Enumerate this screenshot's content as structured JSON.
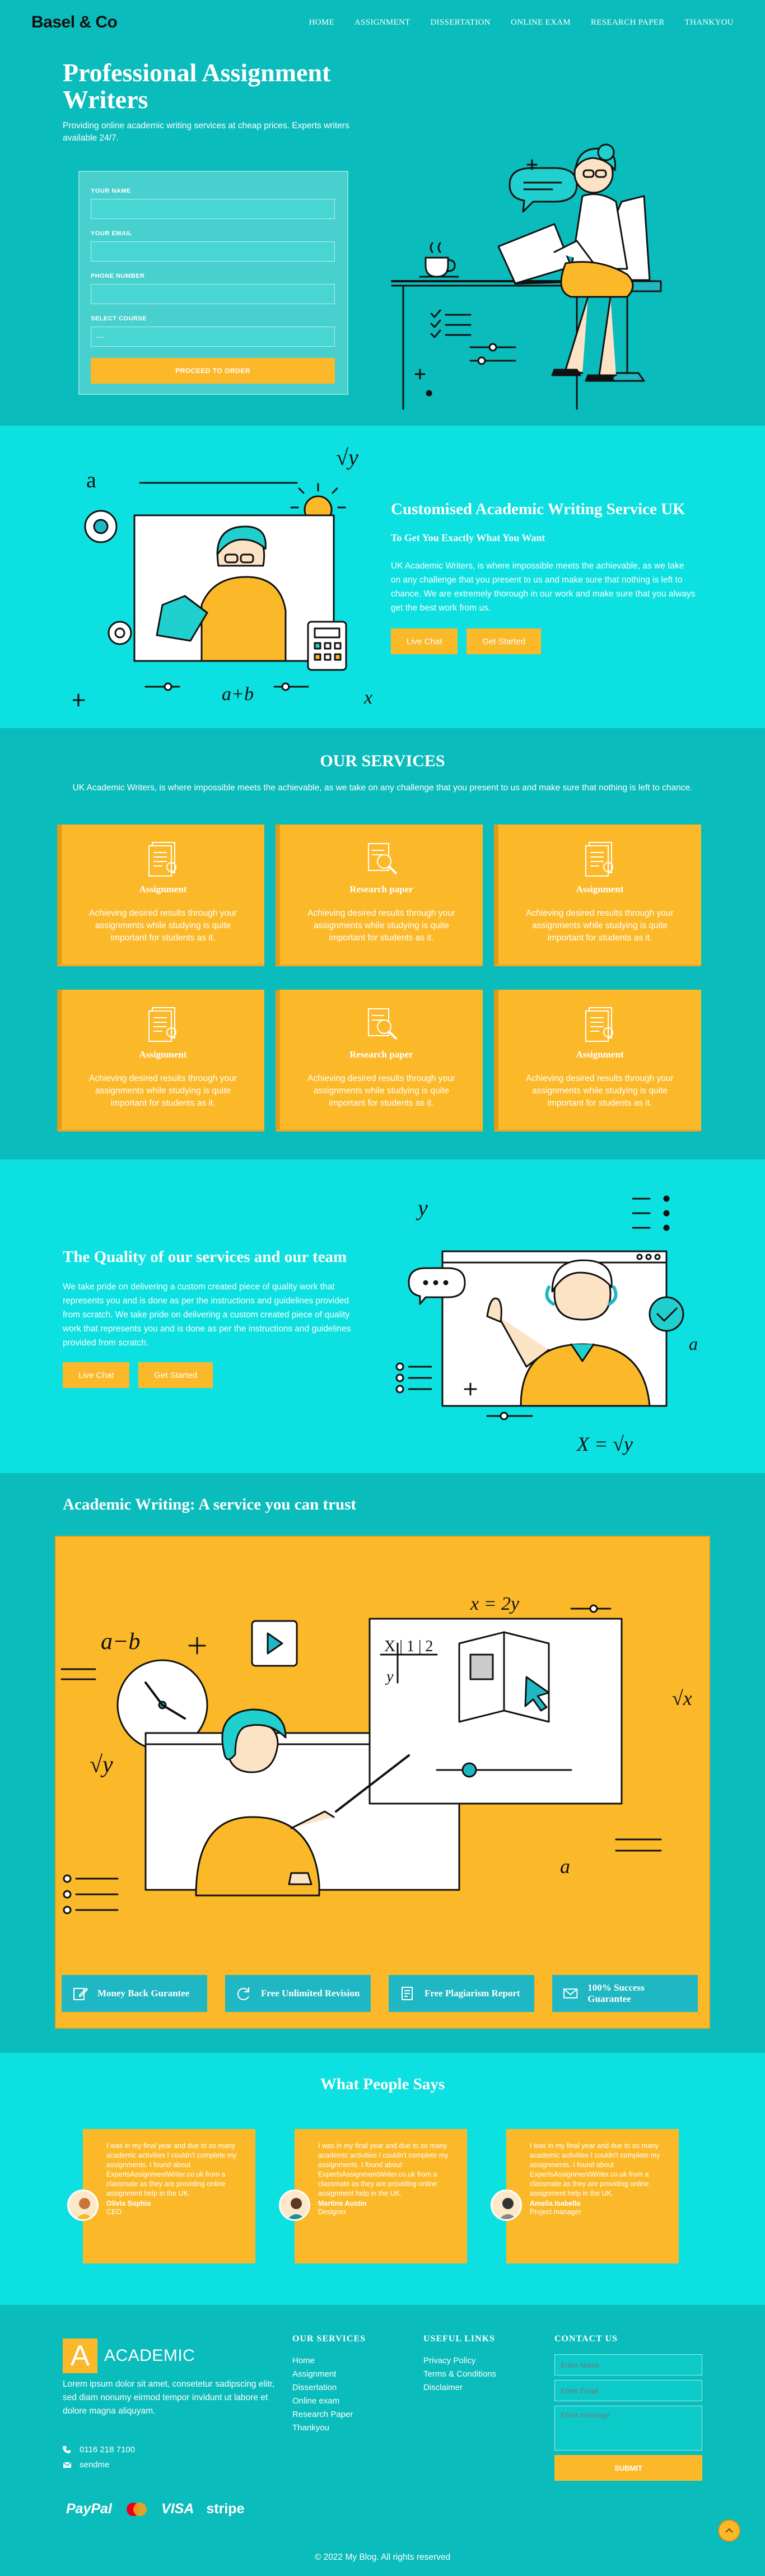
{
  "header": {
    "logo": "Basel & Co",
    "nav": [
      "HOME",
      "ASSIGNMENT",
      "DISSERTATION",
      "ONLINE EXAM",
      "RESEARCH PAPER",
      "THANKYOU"
    ]
  },
  "hero": {
    "title": "Professional Assignment Writers",
    "lead": "Providing online academic writing services at cheap prices. Experts writers available 24/7.",
    "form": {
      "name_label": "YOUR NAME",
      "email_label": "YOUR EMAIL",
      "phone_label": "PHONE NUMBER",
      "course_label": "SELECT COURSE",
      "course_value": "----",
      "submit": "PROCEED TO ORDER"
    }
  },
  "custom": {
    "title": "Customised Academic Writing Service UK",
    "subtitle": "To Get You Exactly What You Want",
    "body": "UK Academic Writers, is where impossible meets the achievable, as we take on any challenge that you present to us and make sure that nothing is left to chance. We are extremely thorough in our work and make sure that you always get the best work from us.",
    "btn_chat": "Live Chat",
    "btn_start": "Get Started"
  },
  "services": {
    "title": "OUR SERVICES",
    "intro": "UK Academic Writers, is where impossible meets the achievable, as we take on any challenge that you present to us and make sure that nothing is left to chance.",
    "items": [
      {
        "title": "Assignment",
        "text": "Achieving desired results through your assignments while studying is quite important for students as it.",
        "icon": "document-icon"
      },
      {
        "title": "Research paper",
        "text": "Achieving desired results through your assignments while studying is quite important for students as it.",
        "icon": "research-icon"
      },
      {
        "title": "Assignment",
        "text": "Achieving desired results through your assignments while studying is quite important for students as it.",
        "icon": "document-icon"
      },
      {
        "title": "Assignment",
        "text": "Achieving desired results through your assignments while studying is quite important for students as it.",
        "icon": "document-icon"
      },
      {
        "title": "Research paper",
        "text": "Achieving desired results through your assignments while studying is quite important for students as it.",
        "icon": "research-icon"
      },
      {
        "title": "Assignment",
        "text": "Achieving desired results through your assignments while studying is quite important for students as it.",
        "icon": "document-icon"
      }
    ]
  },
  "quality": {
    "title": "The Quality of our services and our team",
    "body": "We take pride on delivering a custom created piece of quality work that represents you and is done as per the instructions and guidelines provided from scratch. We take pride on delivering a custom created piece of quality work that represents you and is done as per the instructions and guidelines provided from scratch.",
    "btn_chat": "Live Chat",
    "btn_start": "Get Started"
  },
  "trust": {
    "title": "Academic Writing: A service you can trust",
    "features": [
      {
        "label": "Money Back Gurantee",
        "icon": "edit-icon"
      },
      {
        "label": "Free Unlimited Revision",
        "icon": "refresh-icon"
      },
      {
        "label": "Free Plagiarism Report",
        "icon": "report-icon"
      },
      {
        "label": "100% Success Guarantee",
        "icon": "mail-icon"
      }
    ]
  },
  "testimonials": {
    "title": "What People Says",
    "items": [
      {
        "text": "I was in my final year and due to so many academic activities I couldn't complete my assignments. I found about ExpertsAssignmentWriter.co.uk from a classmate as they are providing online assignment help in the UK.",
        "name": "Olivia Sophia",
        "role": "CEO"
      },
      {
        "text": "I was in my final year and due to so many academic activities I couldn't complete my assignments. I found about ExpertsAssignmentWriter.co.uk from a classmate as they are providing online assignment help in the UK.",
        "name": "Martine Austin",
        "role": "Designer"
      },
      {
        "text": "I was in my final year and due to so many academic activities I couldn't complete my assignments. I found about ExpertsAssignmentWriter.co.uk from a classmate as they are providing online assignment help in the UK.",
        "name": "Amelia Isabella",
        "role": "Project manager"
      }
    ]
  },
  "footer": {
    "logo_mark": "A",
    "logo_name": "ACADEMIC",
    "about": "Lorem ipsum dolor sit amet, consetetur sadipscing elitr, sed diam nonumy eirmod tempor invidunt ut labore et dolore magna aliquyam.",
    "phone": "0116 218 7100",
    "email": "sendme",
    "payments": [
      "PayPal",
      "VISA",
      "stripe"
    ],
    "services_title": "OUR SERVICES",
    "services_links": [
      "Home",
      "Assignment",
      "Dissertation",
      "Online exam",
      "Research Paper",
      "Thankyou"
    ],
    "useful_title": "USEFUL LINKS",
    "useful_links": [
      "Privacy Policy",
      "Terms & Conditions",
      "Disclaimer"
    ],
    "contact_title": "CONTACT US",
    "name_placeholder": "Enter Name",
    "email_placeholder": "Enter Email",
    "message_placeholder": "Enter message",
    "submit": "SUBMIT",
    "copyright": "© 2022 My Blog. All rights reserved"
  },
  "colors": {
    "teal": "#0bbcbc",
    "aqua": "#0de0e0",
    "yellow": "#fbb92a",
    "ink": "#111111"
  }
}
